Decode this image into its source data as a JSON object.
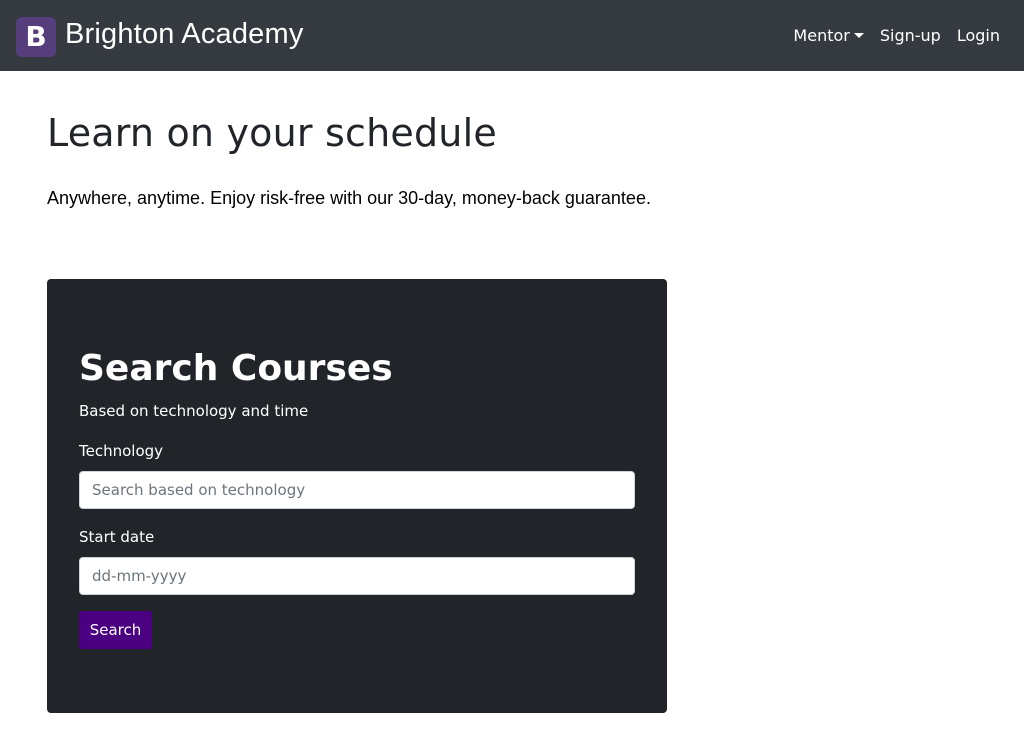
{
  "navbar": {
    "logo_letter": "B",
    "brand_name": "Brighton Academy",
    "links": {
      "mentor": "Mentor",
      "signup": "Sign-up",
      "login": "Login"
    },
    "background": "#343a40"
  },
  "hero": {
    "title": "Learn on your schedule",
    "subtitle": "Anywhere, anytime. Enjoy risk-free with our 30-day, money-back guarantee."
  },
  "search_card": {
    "title": "Search Courses",
    "subtitle": "Based on technology and time",
    "technology_label": "Technology",
    "technology_placeholder": "Search based on technology",
    "start_date_label": "Start date",
    "start_date_placeholder": "dd-mm-yyyy",
    "search_button": "Search",
    "background": "#212529",
    "button_color": "#4b0082"
  }
}
